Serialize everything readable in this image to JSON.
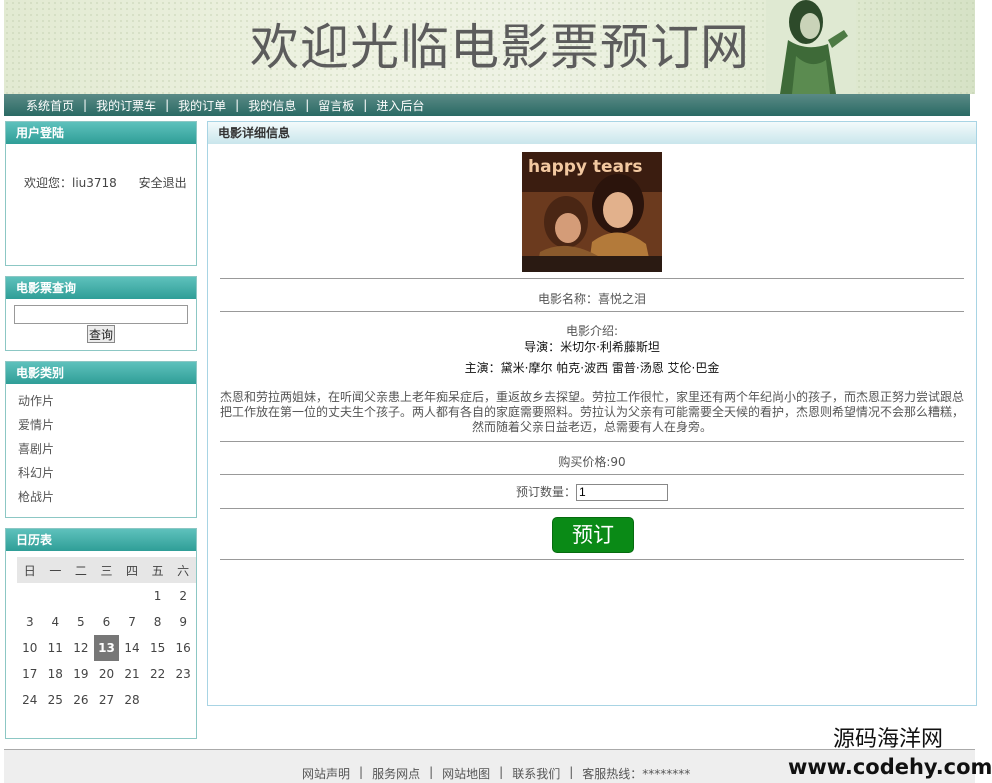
{
  "banner": {
    "title": "欢迎光临电影票预订网"
  },
  "nav": {
    "items": [
      "系统首页",
      "我的订票车",
      "我的订单",
      "我的信息",
      "留言板",
      "进入后台"
    ],
    "separator": "|"
  },
  "login": {
    "header": "用户登陆",
    "welcome": "欢迎您：liu3718",
    "logout": "安全退出"
  },
  "search": {
    "header": "电影票查询",
    "value": "",
    "button": "查询"
  },
  "categories": {
    "header": "电影类别",
    "items": [
      "动作片",
      "爱情片",
      "喜剧片",
      "科幻片",
      "枪战片"
    ]
  },
  "calendar": {
    "header": "日历表",
    "weekdays": [
      "日",
      "一",
      "二",
      "三",
      "四",
      "五",
      "六"
    ],
    "weeks": [
      [
        "",
        "",
        "",
        "",
        "",
        "1",
        "2"
      ],
      [
        "3",
        "4",
        "5",
        "6",
        "7",
        "8",
        "9"
      ],
      [
        "10",
        "11",
        "12",
        "13",
        "14",
        "15",
        "16"
      ],
      [
        "17",
        "18",
        "19",
        "20",
        "21",
        "22",
        "23"
      ],
      [
        "24",
        "25",
        "26",
        "27",
        "28",
        "",
        ""
      ]
    ],
    "today": "13"
  },
  "detail": {
    "header": "电影详细信息",
    "poster_text": "happy tears",
    "name": "电影名称：喜悦之泪",
    "intro_label": "电影介绍:",
    "director_label": "导演：",
    "director": "米切尔·利希藤斯坦",
    "cast_label": "主演：",
    "cast": "黛米·摩尔 帕克·波西 雷普·汤恩 艾伦·巴金",
    "synopsis": "杰恩和劳拉两姐妹，在听闻父亲患上老年痴呆症后，重返故乡去探望。劳拉工作很忙，家里还有两个年纪尚小的孩子，而杰恩正努力尝试跟总把工作放在第一位的丈夫生个孩子。两人都有各自的家庭需要照料。劳拉认为父亲有可能需要全天候的看护，杰恩则希望情况不会那么糟糕，然而随着父亲日益老迈，总需要有人在身旁。",
    "price": "购买价格:90",
    "quantity_label": "预订数量：",
    "quantity": "1",
    "order_button": "预订"
  },
  "footer": {
    "items": [
      "网站声明",
      "服务网点",
      "网站地图",
      "联系我们",
      "客服热线：********"
    ],
    "separator": "|"
  },
  "watermark": {
    "line1": "源码海洋网",
    "line2": "www.codehy.com"
  }
}
